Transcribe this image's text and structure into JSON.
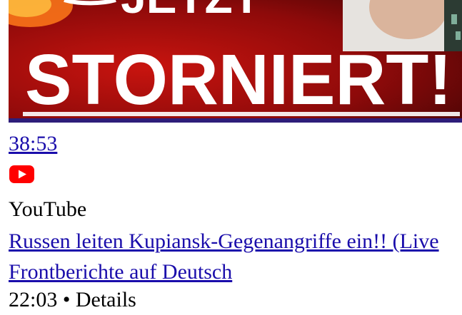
{
  "thumbnail": {
    "text_top": "JETZT",
    "text_main": "STORNIERT!"
  },
  "video": {
    "duration": "38:53",
    "source": "YouTube",
    "title_line1": "Russen leiten Kupiansk-Gegenangriffe ein!! (Live",
    "title_line2": "Frontberichte auf Deutsch",
    "published": "22:03",
    "separator": "•",
    "details_label": "Details"
  },
  "colors": {
    "link": "#1a0dab",
    "youtube_red": "#ff0000",
    "thumb_bg": "#8d0b0b"
  },
  "icons": {
    "source_icon": "youtube-icon"
  }
}
